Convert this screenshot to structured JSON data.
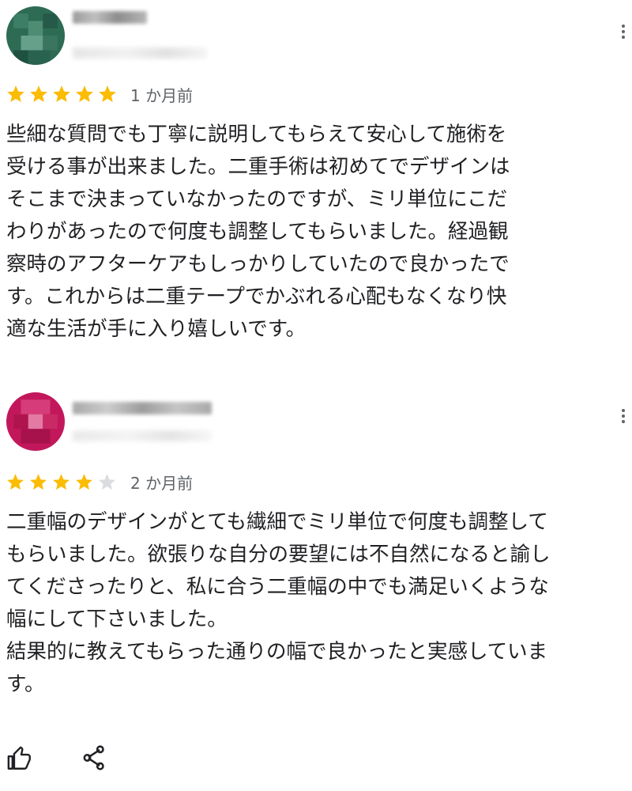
{
  "reviews": [
    {
      "time": "1 か月前",
      "rating": 5,
      "max_rating": 5,
      "avatar_color": "#2e6b54",
      "text": "些細な質問でも丁寧に説明してもらえて安心して施術を\n受ける事が出来ました。二重手術は初めてでデザインは\nそこまで決まっていなかったのですが、ミリ単位にこだ\nわりがあったので何度も調整してもらいました。経過観\n察時のアフターケアもしっかりしていたので良かったで\nす。これからは二重テープでかぶれる心配もなくなり快\n適な生活が手に入り嬉しいです。"
    },
    {
      "time": "2 か月前",
      "rating": 4,
      "max_rating": 5,
      "avatar_color": "#c2185b",
      "text": "二重幅のデザインがとても繊細でミリ単位で何度も調整して\nもらいました。欲張りな自分の要望には不自然になると諭し\nてくださったりと、私に合う二重幅の中でも満足いくような\n幅にして下さいました。\n結果的に教えてもらった通りの幅で良かったと実感していま\nす。"
    }
  ],
  "colors": {
    "star_filled": "#fbbc04",
    "star_empty": "#dadce0",
    "icon": "#202124",
    "secondary_text": "#5f6368"
  },
  "icons": {
    "like": "thumb-up-icon",
    "share": "share-icon",
    "more": "more-vert-icon"
  }
}
